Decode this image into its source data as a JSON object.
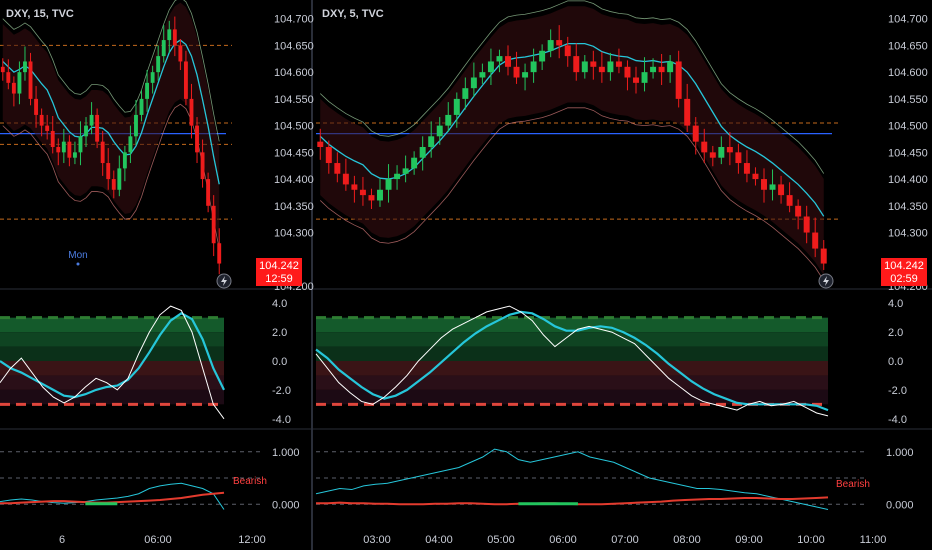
{
  "chart_data": [
    {
      "type": "candlestick",
      "panel": "left",
      "title": "DXY, 15, TVC",
      "ylim": [
        104.2,
        104.72
      ],
      "price_ticks": [
        "104.700",
        "104.650",
        "104.600",
        "104.550",
        "104.500",
        "104.450",
        "104.400",
        "104.350",
        "104.300",
        "104.200"
      ],
      "last_price": "104.242",
      "countdown": "12:59",
      "x_ticks": [
        "6",
        "06:00",
        "12:00"
      ],
      "session_marker": "Mon",
      "dashed_levels": [
        104.65,
        104.505,
        104.465,
        104.325
      ],
      "blue_level": 104.485,
      "close": [
        104.6,
        104.58,
        104.56,
        104.6,
        104.62,
        104.55,
        104.52,
        104.5,
        104.49,
        104.46,
        104.45,
        104.47,
        104.44,
        104.45,
        104.48,
        104.5,
        104.52,
        104.47,
        104.43,
        104.4,
        104.38,
        104.42,
        104.45,
        104.48,
        104.52,
        104.55,
        104.58,
        104.6,
        104.63,
        104.66,
        104.68,
        104.65,
        104.62,
        104.55,
        104.5,
        104.45,
        104.4,
        104.35,
        104.28,
        104.242
      ]
    },
    {
      "type": "candlestick",
      "panel": "right",
      "title": "DXY, 5, TVC",
      "ylim": [
        104.2,
        104.72
      ],
      "price_ticks": [
        "104.700",
        "104.650",
        "104.600",
        "104.550",
        "104.500",
        "104.450",
        "104.400",
        "104.350",
        "104.300",
        "104.200"
      ],
      "last_price": "104.242",
      "countdown": "02:59",
      "x_ticks": [
        "03:00",
        "04:00",
        "05:00",
        "06:00",
        "07:00",
        "08:00",
        "09:00",
        "10:00",
        "11:00"
      ],
      "dashed_levels": [
        104.505,
        104.325
      ],
      "blue_level": 104.485,
      "close": [
        104.46,
        104.43,
        104.41,
        104.39,
        104.38,
        104.37,
        104.36,
        104.38,
        104.4,
        104.41,
        104.42,
        104.44,
        104.46,
        104.48,
        104.5,
        104.52,
        104.55,
        104.57,
        104.59,
        104.6,
        104.62,
        104.63,
        104.61,
        104.59,
        104.6,
        104.62,
        104.64,
        104.66,
        104.65,
        104.63,
        104.6,
        104.62,
        104.61,
        104.6,
        104.62,
        104.61,
        104.59,
        104.58,
        104.6,
        104.61,
        104.6,
        104.62,
        104.55,
        104.5,
        104.47,
        104.45,
        104.44,
        104.46,
        104.45,
        104.43,
        104.41,
        104.4,
        104.38,
        104.39,
        104.37,
        104.35,
        104.33,
        104.3,
        104.27,
        104.242
      ]
    },
    {
      "type": "line",
      "panel": "oscillator",
      "y_ticks": [
        "4.0",
        "2.0",
        "0.0",
        "-2.0",
        "-4.0"
      ],
      "ylim": [
        -4.5,
        4.5
      ],
      "left_series": {
        "fast": [
          -1.5,
          -0.5,
          0.2,
          -0.8,
          -1.8,
          -2.5,
          -2.9,
          -2.5,
          -1.8,
          -1.2,
          -1.5,
          -2.0,
          -1.2,
          0.5,
          2.0,
          3.2,
          3.8,
          3.5,
          2.0,
          -0.5,
          -3.0,
          -4.0
        ],
        "slow": [
          0.0,
          -0.5,
          -0.8,
          -1.2,
          -1.6,
          -2.0,
          -2.4,
          -2.5,
          -2.3,
          -2.0,
          -1.8,
          -1.7,
          -1.3,
          -0.5,
          0.6,
          1.8,
          2.8,
          3.3,
          2.9,
          1.5,
          -0.5,
          -2.0
        ]
      },
      "right_series": {
        "fast": [
          0.5,
          -0.5,
          -1.5,
          -2.2,
          -2.8,
          -3.0,
          -2.5,
          -1.8,
          -1.0,
          0.0,
          0.8,
          1.6,
          2.2,
          2.6,
          3.0,
          3.4,
          3.6,
          3.8,
          3.4,
          2.8,
          1.8,
          1.0,
          1.6,
          2.2,
          2.4,
          2.2,
          2.0,
          1.6,
          1.2,
          0.4,
          -0.4,
          -1.2,
          -1.8,
          -2.4,
          -2.8,
          -3.0,
          -3.2,
          -3.4,
          -3.0,
          -2.8,
          -3.1,
          -3.0,
          -2.8,
          -3.2,
          -3.6,
          -3.8
        ],
        "slow": [
          0.8,
          0.2,
          -0.6,
          -1.2,
          -1.8,
          -2.3,
          -2.6,
          -2.4,
          -2.0,
          -1.4,
          -0.8,
          -0.1,
          0.6,
          1.3,
          1.9,
          2.4,
          2.8,
          3.2,
          3.4,
          3.3,
          2.9,
          2.4,
          2.1,
          2.1,
          2.3,
          2.4,
          2.3,
          2.0,
          1.6,
          1.1,
          0.5,
          -0.2,
          -0.8,
          -1.4,
          -1.9,
          -2.3,
          -2.6,
          -2.9,
          -3.0,
          -3.0,
          -3.0,
          -3.0,
          -3.0,
          -3.0,
          -3.1,
          -3.4
        ]
      }
    },
    {
      "type": "line",
      "panel": "signal",
      "y_ticks": [
        "1.000",
        "0.000"
      ],
      "ylim": [
        -0.3,
        1.3
      ],
      "state_label": "Bearish",
      "left_series": {
        "cyan": [
          0.05,
          0.08,
          0.1,
          0.08,
          0.05,
          0.03,
          0.02,
          0.03,
          0.05,
          0.08,
          0.1,
          0.12,
          0.15,
          0.2,
          0.3,
          0.35,
          0.38,
          0.4,
          0.35,
          0.3,
          0.2,
          -0.1
        ],
        "red": [
          0.02,
          0.02,
          0.03,
          0.04,
          0.05,
          0.06,
          0.06,
          0.05,
          0.04,
          0.03,
          0.03,
          0.04,
          0.05,
          0.06,
          0.07,
          0.08,
          0.1,
          0.12,
          0.15,
          0.18,
          0.2,
          0.22
        ]
      },
      "right_series": {
        "cyan": [
          0.2,
          0.25,
          0.3,
          0.28,
          0.35,
          0.38,
          0.4,
          0.45,
          0.5,
          0.55,
          0.6,
          0.65,
          0.7,
          0.8,
          0.9,
          1.05,
          1.0,
          0.85,
          0.8,
          0.85,
          0.9,
          0.95,
          1.0,
          0.9,
          0.85,
          0.8,
          0.7,
          0.6,
          0.5,
          0.45,
          0.4,
          0.35,
          0.3,
          0.3,
          0.28,
          0.25,
          0.22,
          0.2,
          0.15,
          0.1,
          0.05,
          0.0,
          -0.05,
          -0.1
        ],
        "red": [
          0.02,
          0.02,
          0.03,
          0.02,
          0.02,
          0.01,
          0.01,
          0.0,
          0.0,
          0.0,
          0.01,
          0.01,
          0.02,
          0.02,
          0.01,
          0.0,
          0.0,
          0.01,
          0.01,
          0.02,
          0.02,
          0.01,
          0.0,
          0.0,
          0.0,
          0.01,
          0.02,
          0.03,
          0.04,
          0.05,
          0.07,
          0.08,
          0.09,
          0.1,
          0.1,
          0.11,
          0.12,
          0.12,
          0.11,
          0.1,
          0.1,
          0.11,
          0.12,
          0.13
        ]
      }
    }
  ],
  "colors": {
    "background": "#000000",
    "bull": "#22c55e",
    "bear": "#ef1c1c",
    "price_box": "#ff1a1a",
    "cyan": "#26c6da",
    "blue_level": "#2962ff",
    "dashed": "#c46a1c",
    "grid_text": "#c8ccd6"
  },
  "icons": {
    "alert": "lightning-icon"
  }
}
